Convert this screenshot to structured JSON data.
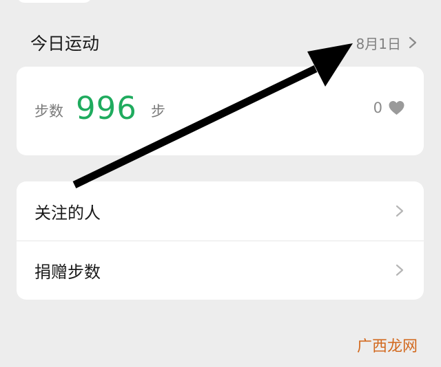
{
  "section": {
    "title": "今日运动",
    "date": "8月1日"
  },
  "steps": {
    "label": "步数",
    "value": "996",
    "unit": "步",
    "likes_count": "0",
    "accent_color": "#1fab5e"
  },
  "menu": {
    "items": [
      {
        "label": "关注的人"
      },
      {
        "label": "捐赠步数"
      }
    ]
  },
  "watermark": "广西龙网",
  "icons": {
    "chevron": "chevron-right-icon",
    "heart": "heart-icon"
  }
}
